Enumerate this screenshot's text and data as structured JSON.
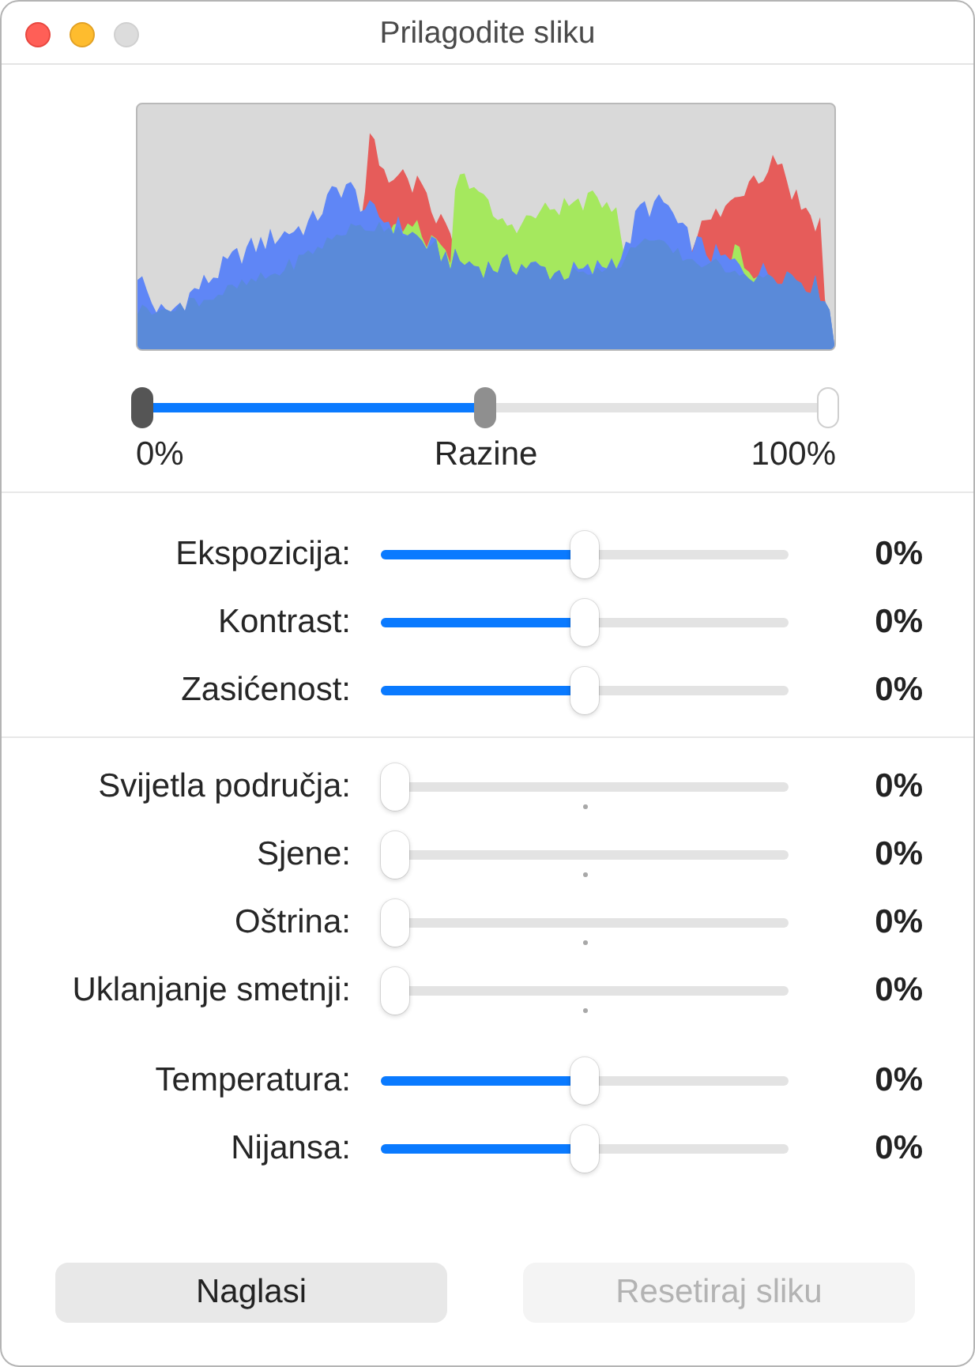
{
  "window": {
    "title": "Prilagodite sliku",
    "controls": [
      {
        "kind": "close",
        "disabled": false
      },
      {
        "kind": "minimize",
        "disabled": false
      },
      {
        "kind": "zoom",
        "disabled": true
      }
    ]
  },
  "levels": {
    "label": "Razine",
    "min_label": "0%",
    "max_label": "100%",
    "thumbs": [
      {
        "kind": "black",
        "level": 0
      },
      {
        "kind": "midtone",
        "level": 0.5
      },
      {
        "kind": "white",
        "level": 1
      }
    ]
  },
  "groups": [
    {
      "divider": true,
      "sliders": [
        {
          "label": "Ekspozicija:",
          "kind": "plain",
          "level": 0.5,
          "reading": "0%"
        },
        {
          "label": "Kontrast:",
          "kind": "plain",
          "level": 0.5,
          "reading": "0%"
        },
        {
          "label": "Zasićenost:",
          "kind": "plain",
          "level": 0.5,
          "reading": "0%"
        }
      ]
    },
    {
      "divider": true,
      "sliders": [
        {
          "label": "Svijetla područja:",
          "kind": "marked",
          "level": 0,
          "reading": "0%"
        },
        {
          "label": "Sjene:",
          "kind": "marked",
          "level": 0,
          "reading": "0%"
        },
        {
          "label": "Oštrina:",
          "kind": "marked",
          "level": 0,
          "reading": "0%"
        },
        {
          "label": "Uklanjanje smetnji:",
          "kind": "marked",
          "level": 0,
          "reading": "0%"
        }
      ]
    },
    {
      "divider": false,
      "sliders": [
        {
          "label": "Temperatura:",
          "kind": "plain",
          "level": 0.5,
          "reading": "0%"
        },
        {
          "label": "Nijansa:",
          "kind": "plain",
          "level": 0.5,
          "reading": "0%"
        }
      ]
    }
  ],
  "buttons": [
    {
      "label": "Naglasi",
      "disabled": false
    },
    {
      "label": "Resetiraj sliku",
      "disabled": true
    }
  ]
}
